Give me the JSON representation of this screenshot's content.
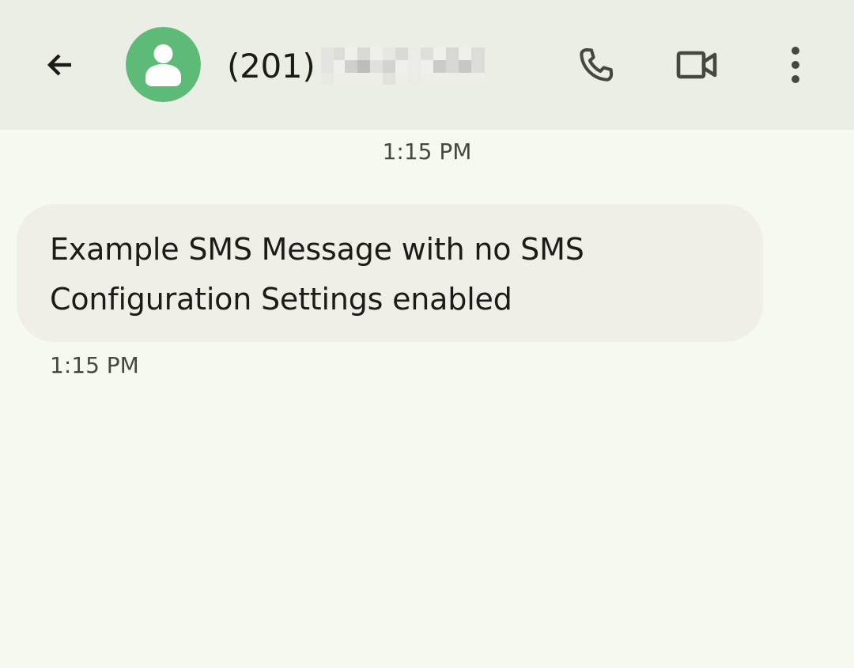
{
  "header": {
    "back_icon": "arrow-back-icon",
    "avatar_icon": "person-icon",
    "avatar_color": "#5dbb77",
    "contact_name": "(201)",
    "call_icon": "phone-icon",
    "video_icon": "video-camera-icon",
    "more_icon": "more-vert-icon"
  },
  "conversation": {
    "date_header": "1:15 PM",
    "messages": [
      {
        "direction": "incoming",
        "text": "Example SMS Message with no SMS Configuration Settings enabled",
        "time": "1:15 PM"
      }
    ]
  },
  "colors": {
    "app_bar": "#ebeee5",
    "background": "#f6f9f0",
    "bubble": "#efefe8",
    "icon": "#44483f"
  }
}
